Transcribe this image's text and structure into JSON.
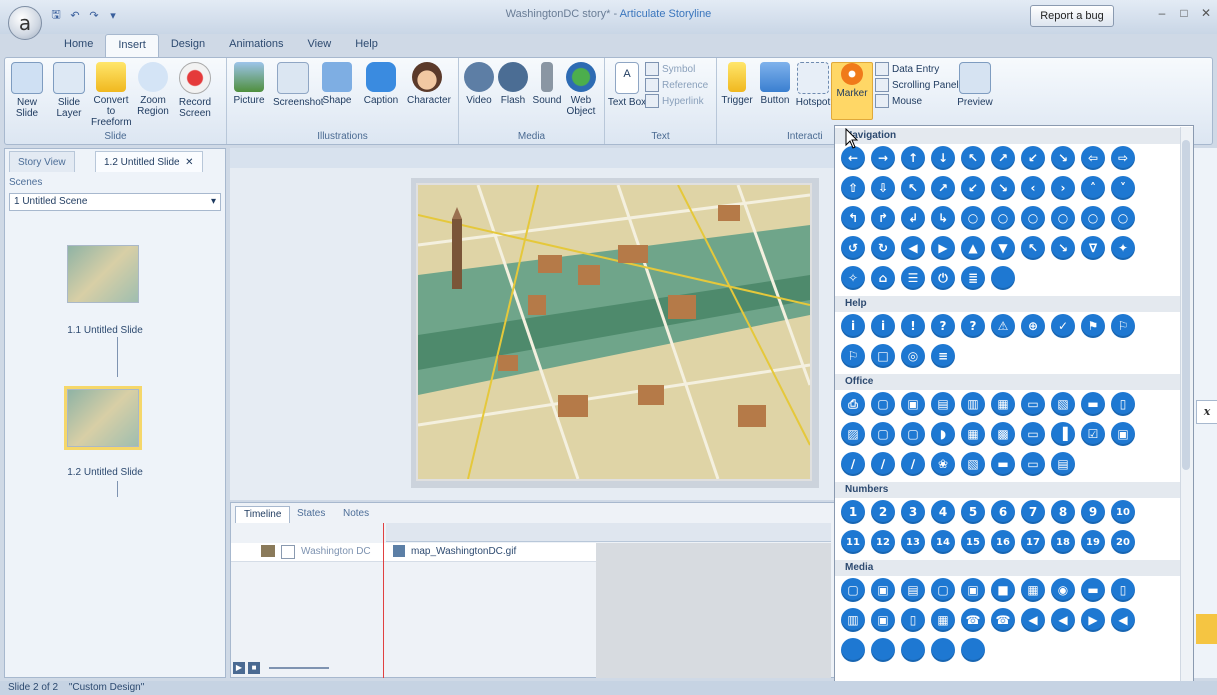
{
  "app": {
    "logo": "a",
    "window_title": "WashingtonDC story* - ",
    "app_name": "Articulate Storyline",
    "report_bug": "Report a bug"
  },
  "quick_access": [
    "save-icon",
    "undo-icon",
    "redo-icon",
    "customize-icon"
  ],
  "ribbon_tabs": [
    {
      "label": "Home",
      "active": false
    },
    {
      "label": "Insert",
      "active": true
    },
    {
      "label": "Design",
      "active": false
    },
    {
      "label": "Animations",
      "active": false
    },
    {
      "label": "View",
      "active": false
    },
    {
      "label": "Help",
      "active": false
    }
  ],
  "ribbon": {
    "slide_group": {
      "label": "Slide",
      "buttons": [
        "New Slide",
        "Slide Layer",
        "Convert to Freeform",
        "Zoom Region",
        "Record Screen"
      ]
    },
    "illustrations_group": {
      "label": "Illustrations",
      "buttons": [
        "Picture",
        "Screenshot",
        "Shape",
        "Caption",
        "Character"
      ]
    },
    "media_group": {
      "label": "Media",
      "buttons": [
        "Video",
        "Flash",
        "Sound",
        "Web Object"
      ]
    },
    "text_group": {
      "label": "Text",
      "buttons": [
        "Text Box"
      ],
      "small": [
        "Symbol",
        "Reference",
        "Hyperlink"
      ]
    },
    "interactive_group": {
      "label": "Interacti",
      "buttons": [
        "Trigger",
        "Button",
        "Hotspot",
        "Marker"
      ],
      "small": [
        "Data Entry",
        "Scrolling Panel",
        "Mouse"
      ]
    },
    "preview": {
      "label": "Preview"
    }
  },
  "left_panel": {
    "tabs": [
      "Story View",
      "1.2 Untitled Slide"
    ],
    "scenes_label": "Scenes",
    "scene_value": "1 Untitled Scene",
    "slides": [
      {
        "label": "1.1 Untitled Slide",
        "selected": false
      },
      {
        "label": "1.2 Untitled Slide",
        "selected": true
      }
    ]
  },
  "timeline": {
    "tabs": [
      "Timeline",
      "States",
      "Notes"
    ],
    "layer_name": "Washington DC",
    "object_name": "map_WashingtonDC.gif"
  },
  "status_bar": {
    "slide": "Slide 2 of 2",
    "theme": "\"Custom Design\""
  },
  "marker_panel": {
    "categories": [
      {
        "name": "Navigation",
        "rows": [
          [
            "←",
            "→",
            "↑",
            "↓",
            "↖",
            "↗",
            "↙",
            "↘",
            "⇦",
            "⇨"
          ],
          [
            "⇧",
            "⇩",
            "↖",
            "↗",
            "↙",
            "↘",
            "‹",
            "›",
            "˄",
            "˅"
          ],
          [
            "↰",
            "↱",
            "↲",
            "↳",
            "○",
            "○",
            "○",
            "○",
            "○",
            "○"
          ],
          [
            "↺",
            "↻",
            "◀",
            "▶",
            "▲",
            "▼",
            "↖",
            "↘",
            "∇",
            "✦"
          ],
          [
            "✧",
            "⌂",
            "☰",
            "⏻",
            "≣",
            ""
          ]
        ]
      },
      {
        "name": "Help",
        "rows": [
          [
            "i",
            "i",
            "!",
            "?",
            "?",
            "⚠",
            "⊕",
            "✓",
            "⚑",
            "⚐"
          ],
          [
            "⚐",
            "□",
            "◎",
            "≡"
          ]
        ]
      },
      {
        "name": "Office",
        "rows": [
          [
            "⎙",
            "▢",
            "▣",
            "▤",
            "▥",
            "▦",
            "▭",
            "▧",
            "▬",
            "▯"
          ],
          [
            "▨",
            "▢",
            "▢",
            "◗",
            "▦",
            "▩",
            "▭",
            "▐",
            "☑",
            "▣"
          ],
          [
            "∕",
            "∕",
            "∕",
            "❀",
            "▧",
            "▬",
            "▭",
            "▤"
          ]
        ]
      },
      {
        "name": "Numbers",
        "rows": [
          [
            "1",
            "2",
            "3",
            "4",
            "5",
            "6",
            "7",
            "8",
            "9",
            "10"
          ],
          [
            "11",
            "12",
            "13",
            "14",
            "15",
            "16",
            "17",
            "18",
            "19",
            "20"
          ]
        ]
      },
      {
        "name": "Media",
        "rows": [
          [
            "▢",
            "▣",
            "▤",
            "▢",
            "▣",
            "■",
            "▦",
            "◉",
            "▬",
            "▯"
          ],
          [
            "▥",
            "▣",
            "▯",
            "▦",
            "☎",
            "☎",
            "◀",
            "◀",
            "▶",
            "◀"
          ],
          [
            "",
            "",
            "",
            "",
            ""
          ]
        ]
      }
    ]
  }
}
